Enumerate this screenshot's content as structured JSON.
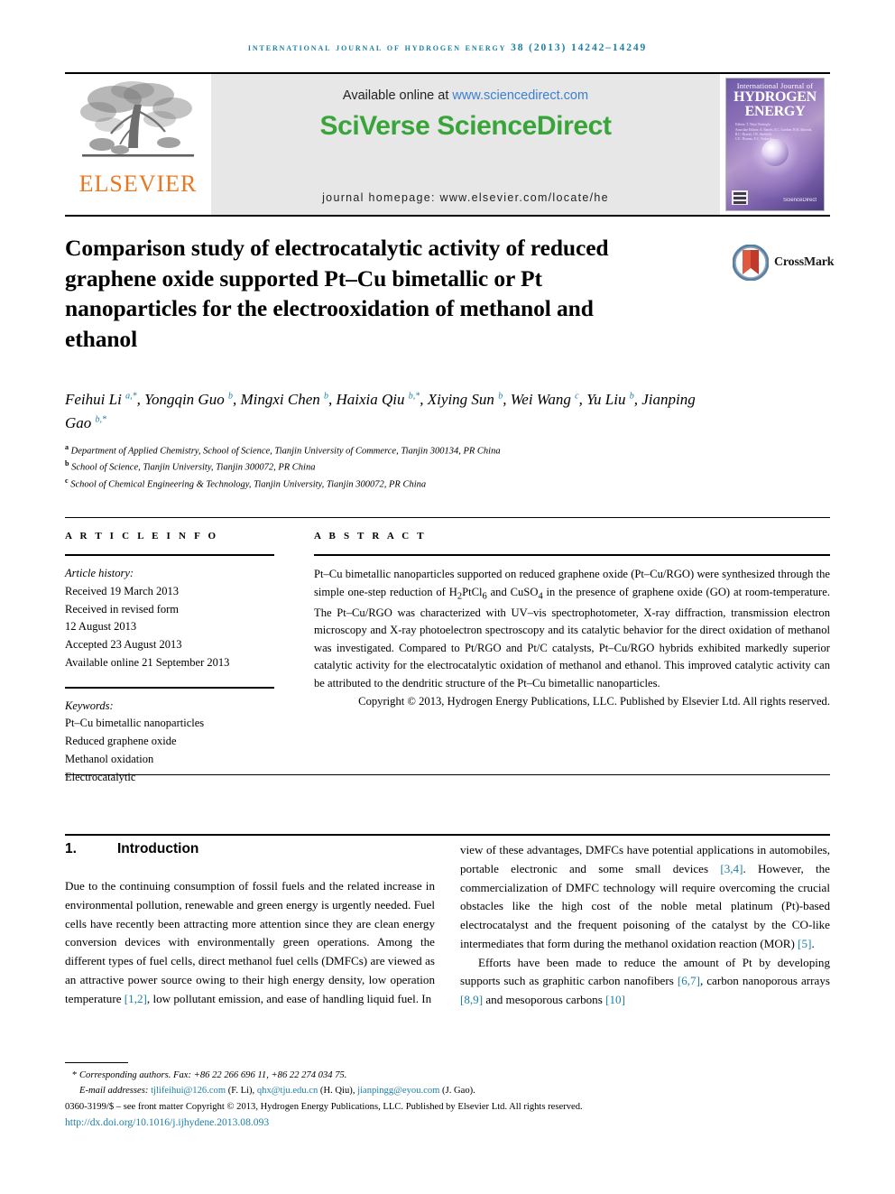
{
  "running_head": "International Journal of Hydrogen Energy 38 (2013) 14242–14249",
  "masthead": {
    "publisher_name": "ELSEVIER",
    "available_prefix": "Available online at ",
    "available_url": "www.sciencedirect.com",
    "sciencedirect_logo": "SciVerse ScienceDirect",
    "journal_homepage": "journal homepage: www.elsevier.com/locate/he",
    "cover": {
      "line1": "International Journal of",
      "line2": "HYDROGEN",
      "line3": "ENERGY",
      "editors": "Editors: T. Nejat Veziroglu\nAssociate Editors: A. Bartels, E.C. Gardner, H.H. Almeida,\nR.C. Hyseni, J.W. Sheffield,\nC.E. Thomas, E.C. Varkaraki",
      "sciencedirect_mark": "ScienceDirect"
    }
  },
  "crossmark": {
    "label": "CrossMark"
  },
  "article": {
    "title": "Comparison study of electrocatalytic activity of reduced graphene oxide supported Pt–Cu bimetallic or Pt nanoparticles for the electrooxidation of methanol and ethanol",
    "authors_html": "Feihui Li <sup>a,*</sup>, Yongqin Guo <sup>b</sup>, Mingxi Chen <sup>b</sup>, Haixia Qiu <sup>b,*</sup>, Xiying Sun <sup>b</sup>, Wei Wang <sup>c</sup>, Yu Liu <sup>b</sup>, Jianping Gao <sup>b,*</sup>",
    "affiliations": [
      {
        "mark": "a",
        "text": "Department of Applied Chemistry, School of Science, Tianjin University of Commerce, Tianjin 300134, PR China"
      },
      {
        "mark": "b",
        "text": "School of Science, Tianjin University, Tianjin 300072, PR China"
      },
      {
        "mark": "c",
        "text": "School of Chemical Engineering & Technology, Tianjin University, Tianjin 300072, PR China"
      }
    ]
  },
  "article_info": {
    "heading": "A R T I C L E    I N F O",
    "history_label": "Article history:",
    "history": [
      "Received 19 March 2013",
      "Received in revised form",
      "12 August 2013",
      "Accepted 23 August 2013",
      "Available online 21 September 2013"
    ],
    "keywords_label": "Keywords:",
    "keywords": [
      "Pt–Cu bimetallic nanoparticles",
      "Reduced graphene oxide",
      "Methanol oxidation",
      "Electrocatalytic"
    ]
  },
  "abstract": {
    "heading": "A B S T R A C T",
    "text_html": "Pt–Cu bimetallic nanoparticles supported on reduced graphene oxide (Pt–Cu/RGO) were synthesized through the simple one-step reduction of H<sub>2</sub>PtCl<sub>6</sub> and CuSO<sub>4</sub> in the presence of graphene oxide (GO) at room-temperature. The Pt–Cu/RGO was characterized with UV–vis spectrophotometer, X-ray diffraction, transmission electron microscopy and X-ray photoelectron spectroscopy and its catalytic behavior for the direct oxidation of methanol was investigated. Compared to Pt/RGO and Pt/C catalysts, Pt–Cu/RGO hybrids exhibited markedly superior catalytic activity for the electrocatalytic oxidation of methanol and ethanol. This improved catalytic activity can be attributed to the dendritic structure of the Pt–Cu bimetallic nanoparticles.",
    "copyright": "Copyright © 2013, Hydrogen Energy Publications, LLC. Published by Elsevier Ltd. All rights reserved."
  },
  "body": {
    "section_number": "1.",
    "section_title": "Introduction",
    "left_html": "Due to the continuing consumption of fossil fuels and the related increase in environmental pollution, renewable and green energy is urgently needed. Fuel cells have recently been attracting more attention since they are clean energy conversion devices with environmentally green operations. Among the different types of fuel cells, direct methanol fuel cells (DMFCs) are viewed as an attractive power source owing to their high energy density, low operation temperature <span class=\"ref\">[1,2]</span>, low pollutant emission, and ease of handling liquid fuel. In",
    "right_html_1": "view of these advantages, DMFCs have potential applications in automobiles, portable electronic and some small devices <span class=\"ref\">[3,4]</span>. However, the commercialization of DMFC technology will require overcoming the crucial obstacles like the high cost of the noble metal platinum (Pt)-based electrocatalyst and the frequent poisoning of the catalyst by the CO-like intermediates that form during the methanol oxidation reaction (MOR) <span class=\"ref\">[5]</span>.",
    "right_html_2": "Efforts have been made to reduce the amount of Pt by developing supports such as graphitic carbon nanofibers <span class=\"ref\">[6,7]</span>, carbon nanoporous arrays <span class=\"ref\">[8,9]</span> and mesoporous carbons <span class=\"ref\">[10]</span>"
  },
  "footnotes": {
    "corresponding_html": "<span class=\"star\">*</span> <i>Corresponding authors.</i> Fax: +86 22 266 696 11, +86 22 274 034 75.",
    "email_html": "<span class=\"lbl\">E-mail addresses:</span> <span class=\"link\">tjlifeihui@126.com</span> (F. Li), <span class=\"link\">qhx@tju.edu.cn</span> (H. Qiu), <span class=\"link\">jianpingg@eyou.com</span> (J. Gao).",
    "issn_line": "0360-3199/$ – see front matter Copyright © 2013, Hydrogen Energy Publications, LLC. Published by Elsevier Ltd. All rights reserved.",
    "doi": "http://dx.doi.org/10.1016/j.ijhydene.2013.08.093"
  },
  "colors": {
    "accent_blue": "#1b7fa8",
    "elsevier_orange": "#E87722",
    "sciencedirect_green": "#39a43a",
    "link_blue": "#3a7fd0"
  }
}
